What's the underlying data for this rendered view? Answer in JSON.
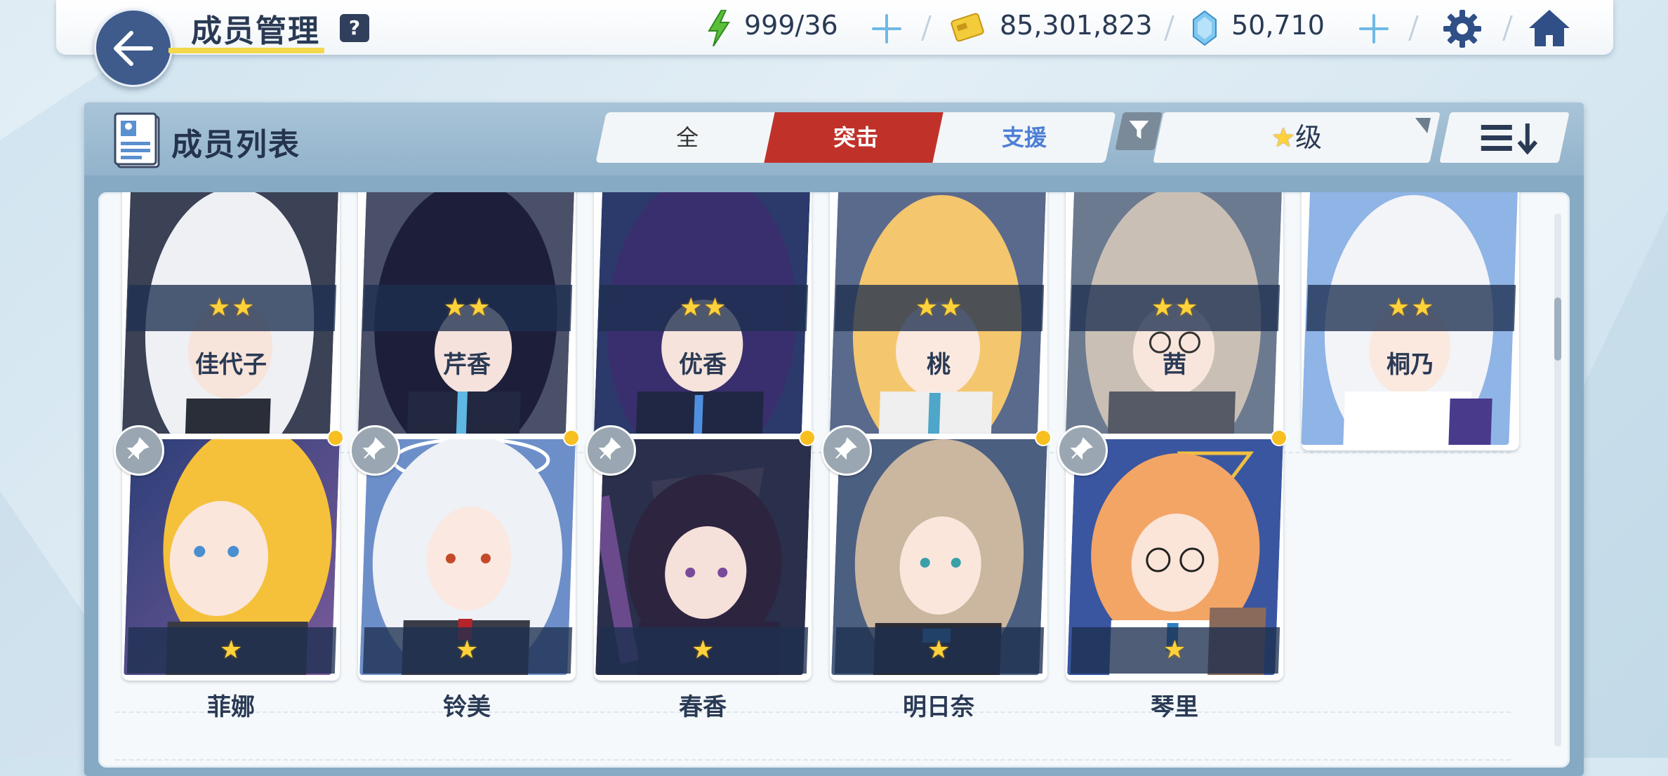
{
  "header": {
    "title": "成员管理",
    "help_label": "?",
    "ap": "999/36",
    "credits": "85,301,823",
    "gems": "50,710"
  },
  "panel": {
    "title": "成员列表",
    "tabs": [
      "全",
      "突击",
      "支援"
    ],
    "active_tab": "突击",
    "sort_label": "级"
  },
  "members_top_row": [
    {
      "name": "佳代子",
      "stars": "★★"
    },
    {
      "name": "芹香",
      "stars": "★★"
    },
    {
      "name": "优香",
      "stars": "★★"
    },
    {
      "name": "桃",
      "stars": "★★"
    },
    {
      "name": "茜",
      "stars": "★★"
    },
    {
      "name": "桐乃",
      "stars": "★★"
    }
  ],
  "members_bottom_row": [
    {
      "name": "菲娜",
      "stars": "★"
    },
    {
      "name": "铃美",
      "stars": "★"
    },
    {
      "name": "春香",
      "stars": "★"
    },
    {
      "name": "明日奈",
      "stars": "★"
    },
    {
      "name": "琴里",
      "stars": "★"
    }
  ],
  "colors": {
    "accent_red": "#c0312a",
    "navy": "#3e5b8c",
    "star_gold": "#ffd23b",
    "support_blue": "#4e7fd6"
  }
}
